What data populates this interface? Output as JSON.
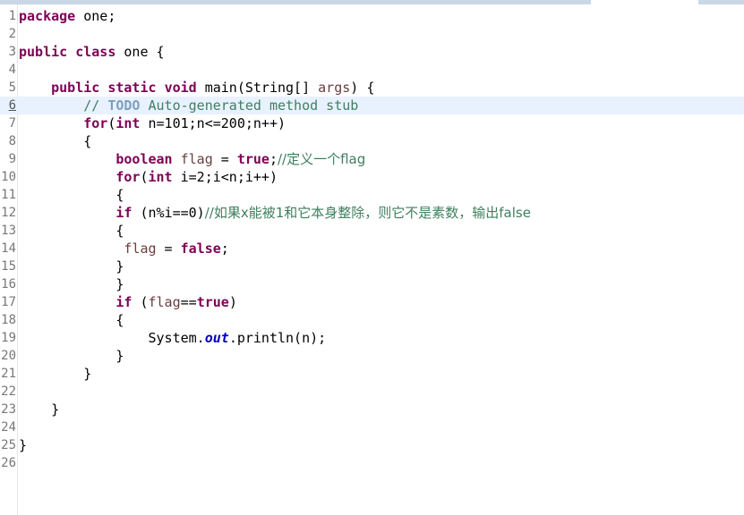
{
  "editor": {
    "lines": [
      {
        "num": "1",
        "tokens": [
          {
            "t": "package",
            "c": "kw"
          },
          {
            "t": " one;"
          }
        ]
      },
      {
        "num": "2",
        "tokens": []
      },
      {
        "num": "3",
        "tokens": [
          {
            "t": "public",
            "c": "kw"
          },
          {
            "t": " "
          },
          {
            "t": "class",
            "c": "kw"
          },
          {
            "t": " one {"
          }
        ]
      },
      {
        "num": "4",
        "tokens": []
      },
      {
        "num": "5",
        "tokens": [
          {
            "t": "    "
          },
          {
            "t": "public",
            "c": "kw"
          },
          {
            "t": " "
          },
          {
            "t": "static",
            "c": "kw"
          },
          {
            "t": " "
          },
          {
            "t": "void",
            "c": "kw"
          },
          {
            "t": " main(String[] "
          },
          {
            "t": "args",
            "c": "vr"
          },
          {
            "t": ") {"
          }
        ]
      },
      {
        "num": "6",
        "current": true,
        "tokens": [
          {
            "t": "        "
          },
          {
            "t": "// ",
            "c": "cm"
          },
          {
            "t": "TODO",
            "c": "todo"
          },
          {
            "t": " Auto-generated method stub",
            "c": "cm"
          }
        ]
      },
      {
        "num": "7",
        "tokens": [
          {
            "t": "        "
          },
          {
            "t": "for",
            "c": "kw"
          },
          {
            "t": "("
          },
          {
            "t": "int",
            "c": "kw"
          },
          {
            "t": " n=101;n<=200;n++)"
          }
        ]
      },
      {
        "num": "8",
        "tokens": [
          {
            "t": "        {"
          }
        ]
      },
      {
        "num": "9",
        "tokens": [
          {
            "t": "            "
          },
          {
            "t": "boolean",
            "c": "kw"
          },
          {
            "t": " "
          },
          {
            "t": "flag",
            "c": "vr"
          },
          {
            "t": " = "
          },
          {
            "t": "true",
            "c": "kw"
          },
          {
            "t": ";"
          },
          {
            "t": "//定义一个flag",
            "c": "cm zh"
          }
        ]
      },
      {
        "num": "10",
        "tokens": [
          {
            "t": "            "
          },
          {
            "t": "for",
            "c": "kw"
          },
          {
            "t": "("
          },
          {
            "t": "int",
            "c": "kw"
          },
          {
            "t": " i=2;i<n;i++)"
          }
        ]
      },
      {
        "num": "11",
        "tokens": [
          {
            "t": "            {"
          }
        ]
      },
      {
        "num": "12",
        "tokens": [
          {
            "t": "            "
          },
          {
            "t": "if",
            "c": "kw"
          },
          {
            "t": " (n%i==0)"
          },
          {
            "t": "//如果x能被1和它本身整除，则它不是素数，输出false",
            "c": "cm zh"
          }
        ]
      },
      {
        "num": "13",
        "tokens": [
          {
            "t": "            {"
          }
        ]
      },
      {
        "num": "14",
        "tokens": [
          {
            "t": "             "
          },
          {
            "t": "flag",
            "c": "vr"
          },
          {
            "t": " = "
          },
          {
            "t": "false",
            "c": "kw"
          },
          {
            "t": ";"
          }
        ]
      },
      {
        "num": "15",
        "tokens": [
          {
            "t": "            }"
          }
        ]
      },
      {
        "num": "16",
        "tokens": [
          {
            "t": "            }"
          }
        ]
      },
      {
        "num": "17",
        "tokens": [
          {
            "t": "            "
          },
          {
            "t": "if",
            "c": "kw"
          },
          {
            "t": " ("
          },
          {
            "t": "flag",
            "c": "vr"
          },
          {
            "t": "=="
          },
          {
            "t": "true",
            "c": "kw"
          },
          {
            "t": ")"
          }
        ]
      },
      {
        "num": "18",
        "tokens": [
          {
            "t": "            {"
          }
        ]
      },
      {
        "num": "19",
        "tokens": [
          {
            "t": "                System."
          },
          {
            "t": "out",
            "c": "fld"
          },
          {
            "t": ".println(n);"
          }
        ]
      },
      {
        "num": "20",
        "tokens": [
          {
            "t": "            }"
          }
        ]
      },
      {
        "num": "21",
        "tokens": [
          {
            "t": "        }"
          }
        ]
      },
      {
        "num": "22",
        "tokens": []
      },
      {
        "num": "23",
        "tokens": [
          {
            "t": "    }"
          }
        ]
      },
      {
        "num": "24",
        "tokens": []
      },
      {
        "num": "25",
        "tokens": [
          {
            "t": "}"
          }
        ]
      },
      {
        "num": "26",
        "tokens": []
      }
    ]
  }
}
